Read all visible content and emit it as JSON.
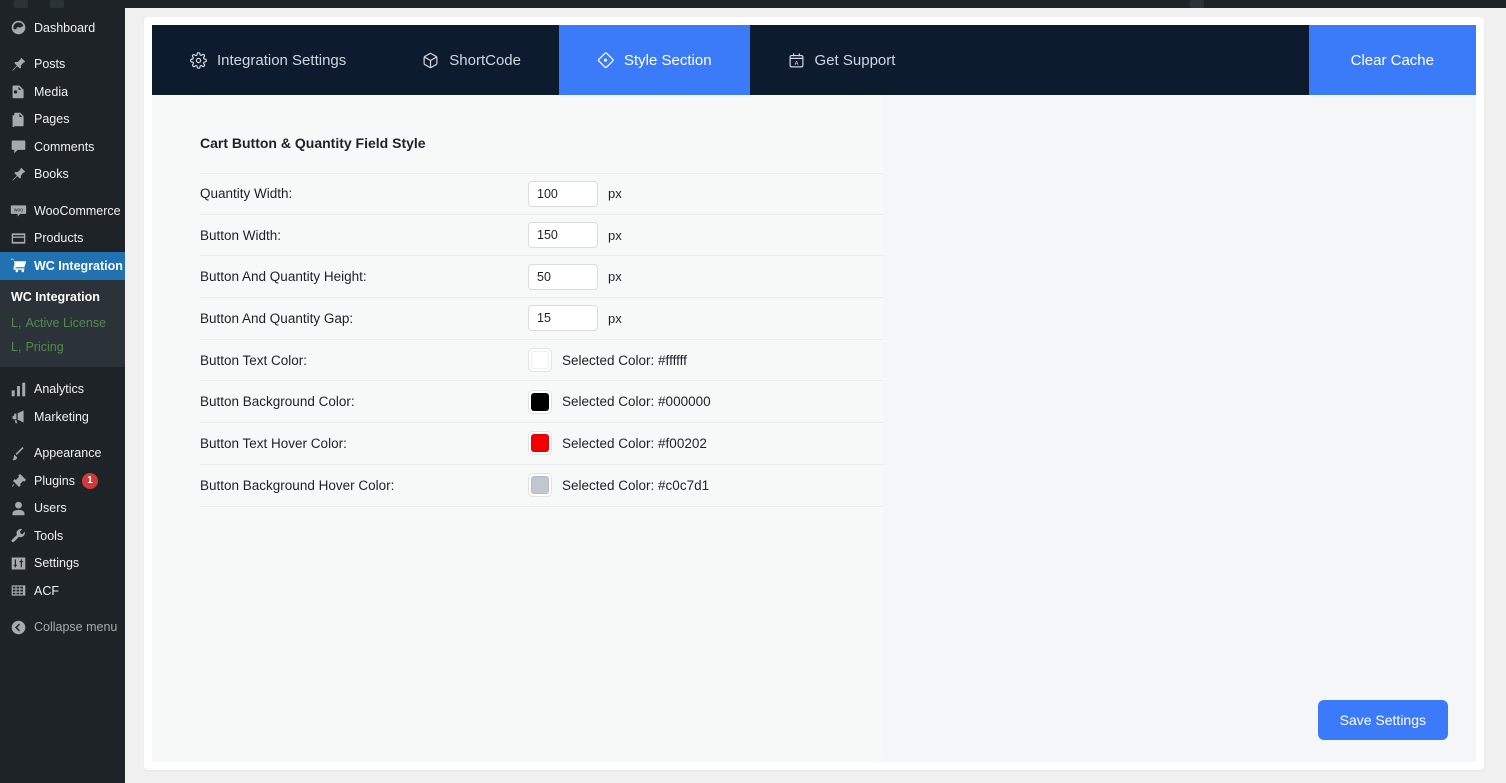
{
  "sidebar": {
    "items": [
      {
        "label": "Dashboard",
        "icon": "dashboard-icon",
        "current": false,
        "badge": null
      },
      {
        "label": "Posts",
        "icon": "pin-icon",
        "current": false,
        "badge": null
      },
      {
        "label": "Media",
        "icon": "media-icon",
        "current": false,
        "badge": null
      },
      {
        "label": "Pages",
        "icon": "pages-icon",
        "current": false,
        "badge": null
      },
      {
        "label": "Comments",
        "icon": "comment-icon",
        "current": false,
        "badge": null
      },
      {
        "label": "Books",
        "icon": "pin-icon",
        "current": false,
        "badge": null
      },
      {
        "label": "WooCommerce",
        "icon": "woocommerce-icon",
        "current": false,
        "badge": null
      },
      {
        "label": "Products",
        "icon": "products-icon",
        "current": false,
        "badge": null
      },
      {
        "label": "WC Integration",
        "icon": "cart-icon",
        "current": true,
        "badge": null
      },
      {
        "label": "Analytics",
        "icon": "chart-bars-icon",
        "current": false,
        "badge": null
      },
      {
        "label": "Marketing",
        "icon": "megaphone-icon",
        "current": false,
        "badge": null
      },
      {
        "label": "Appearance",
        "icon": "paintbrush-icon",
        "current": false,
        "badge": null
      },
      {
        "label": "Plugins",
        "icon": "plug-icon",
        "current": false,
        "badge": "1"
      },
      {
        "label": "Users",
        "icon": "user-icon",
        "current": false,
        "badge": null
      },
      {
        "label": "Tools",
        "icon": "wrench-icon",
        "current": false,
        "badge": null
      },
      {
        "label": "Settings",
        "icon": "sliders-icon",
        "current": false,
        "badge": null
      },
      {
        "label": "ACF",
        "icon": "acf-grid-icon",
        "current": false,
        "badge": null
      }
    ],
    "submenu": {
      "heading": "WC Integration",
      "items": [
        {
          "prefix": "L,",
          "label": "Active License"
        },
        {
          "prefix": "L,",
          "label": "Pricing"
        }
      ]
    },
    "collapse": {
      "label": "Collapse menu",
      "icon": "collapse-arrow-icon"
    }
  },
  "tabs": [
    {
      "label": "Integration Settings",
      "icon": "gear-icon",
      "active": false
    },
    {
      "label": "ShortCode",
      "icon": "cube-icon",
      "active": false
    },
    {
      "label": "Style Section",
      "icon": "diamond-icon",
      "active": true
    },
    {
      "label": "Get Support",
      "icon": "ticket-icon",
      "active": false
    }
  ],
  "clear_cache_label": "Clear Cache",
  "form": {
    "title": "Cart Button & Quantity Field Style",
    "rows": [
      {
        "label": "Quantity Width:",
        "type": "number",
        "value": "100",
        "unit": "px"
      },
      {
        "label": "Button Width:",
        "type": "number",
        "value": "150",
        "unit": "px"
      },
      {
        "label": "Button And Quantity Height:",
        "type": "number",
        "value": "50",
        "unit": "px"
      },
      {
        "label": "Button And Quantity Gap:",
        "type": "number",
        "value": "15",
        "unit": "px"
      },
      {
        "label": "Button Text Color:",
        "type": "color",
        "color": "#ffffff",
        "text": "Selected Color: #ffffff"
      },
      {
        "label": "Button Background Color:",
        "type": "color",
        "color": "#000000",
        "text": "Selected Color: #000000"
      },
      {
        "label": "Button Text Hover Color:",
        "type": "color",
        "color": "#f00202",
        "text": "Selected Color: #f00202"
      },
      {
        "label": "Button Background Hover Color:",
        "type": "color",
        "color": "#c0c7d1",
        "text": "Selected Color: #c0c7d1"
      }
    ]
  },
  "save_label": "Save Settings",
  "theme": {
    "accent": "#3b7bfa",
    "tabbar_bg": "#0d1b2e",
    "sidebar_bg": "#1d2327",
    "sidebar_current": "#2271b1",
    "submenu_bg": "#2c3338",
    "submenu_link": "#4f8a4f",
    "badge": "#d63638"
  }
}
